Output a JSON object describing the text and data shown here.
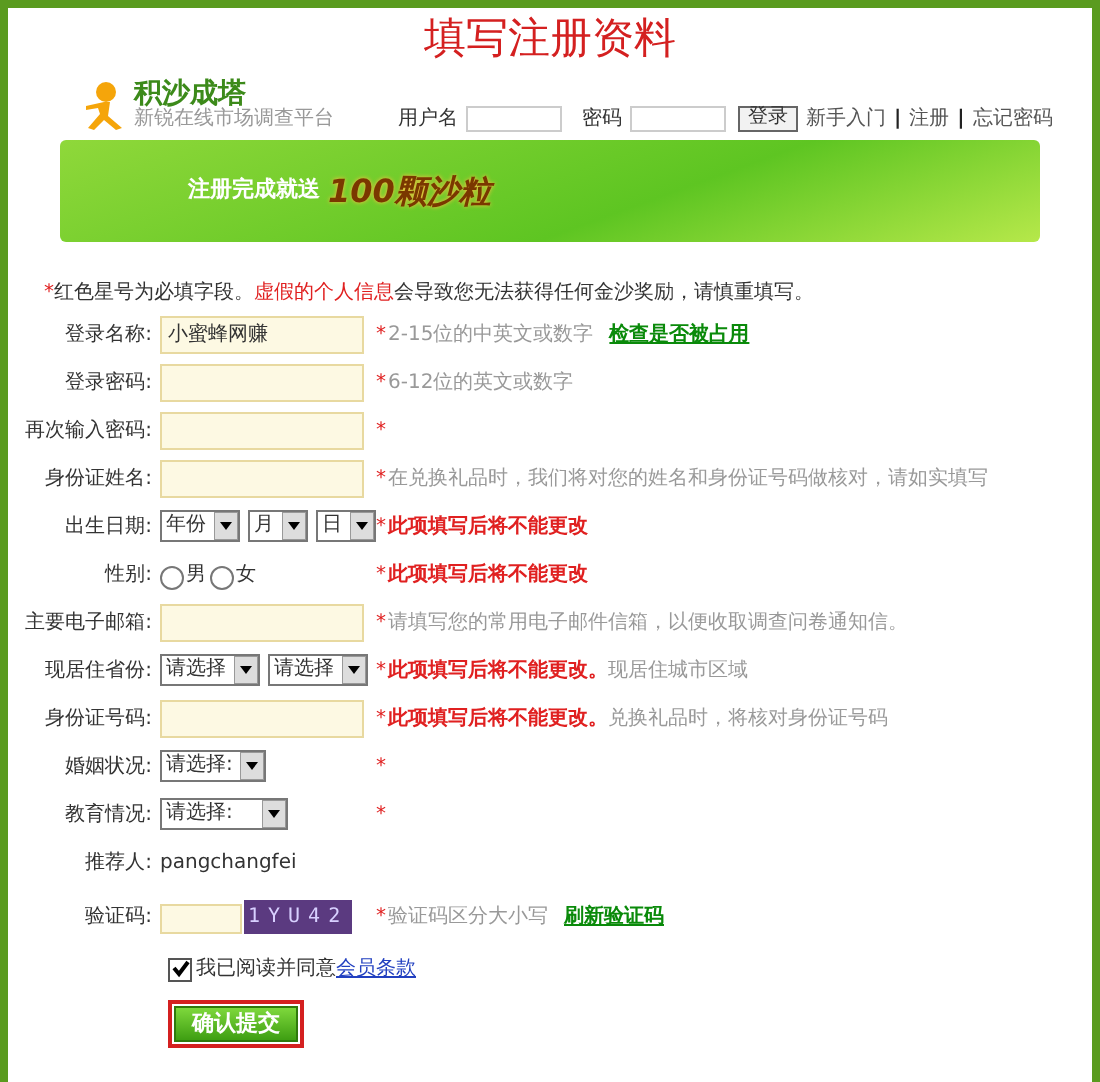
{
  "page_title": "填写注册资料",
  "logo": {
    "name": "积沙成塔",
    "slogan": "新锐在线市场调查平台"
  },
  "login": {
    "username_label": "用户名",
    "password_label": "密码",
    "button": "登录",
    "nav": [
      {
        "kind": "link",
        "text": "新手入门"
      },
      {
        "kind": "sep",
        "text": "|"
      },
      {
        "kind": "link",
        "text": "注册"
      },
      {
        "kind": "sep",
        "text": "|"
      },
      {
        "kind": "link",
        "text": "忘记密码"
      }
    ]
  },
  "banner": {
    "text": "注册完成就送",
    "highlight": "100颗沙粒"
  },
  "intro": {
    "star": "*",
    "text": "红色星号为必填字段。",
    "warning": "虚假的个人信息",
    "rest": "会导致您无法获得任何金沙奖励，请慎重填写。"
  },
  "fields": [
    {
      "label": "登录名称:",
      "kind": "input",
      "value": "小蜜蜂网赚",
      "star": "*",
      "notes": [
        {
          "kind": "hint",
          "text": "2-15位的中英文或数字"
        },
        {
          "kind": "link",
          "text": "检查是否被占用"
        }
      ]
    },
    {
      "label": "登录密码:",
      "kind": "input",
      "star": "*",
      "notes": [
        {
          "kind": "hint",
          "text": "6-12位的英文或数字"
        }
      ]
    },
    {
      "label": "再次输入密码:",
      "kind": "input",
      "star": "*"
    },
    {
      "label": "身份证姓名:",
      "kind": "input",
      "star": "*",
      "notes": [
        {
          "kind": "hint",
          "text": "在兑换礼品时，我们将对您的姓名和身份证号码做核对，请如实填写"
        }
      ]
    },
    {
      "label": "出生日期:",
      "kind": "selects",
      "selects": [
        "年份",
        "月",
        "日"
      ],
      "star": "*",
      "notes": [
        {
          "kind": "warn",
          "text": "此项填写后将不能更改"
        }
      ]
    },
    {
      "label": "性别:",
      "kind": "radios",
      "options": [
        {
          "label": "男",
          "selected": false
        },
        {
          "label": "女",
          "selected": false
        }
      ],
      "star": "*",
      "notes": [
        {
          "kind": "warn",
          "text": "此项填写后将不能更改"
        }
      ]
    },
    {
      "label": "主要电子邮箱:",
      "kind": "input",
      "star": "*",
      "notes": [
        {
          "kind": "hint",
          "text": "请填写您的常用电子邮件信箱，以便收取调查问卷通知信。"
        }
      ]
    },
    {
      "label": "现居住省份:",
      "kind": "selects",
      "selects": [
        "请选择",
        "请选择"
      ],
      "star": "*",
      "notes": [
        {
          "kind": "warn",
          "text": "此项填写后将不能更改。"
        },
        {
          "kind": "hint",
          "text": "现居住城市区域"
        }
      ]
    },
    {
      "label": "身份证号码:",
      "kind": "input",
      "star": "*",
      "notes": [
        {
          "kind": "warn",
          "text": "此项填写后将不能更改。"
        },
        {
          "kind": "hint",
          "text": "兑换礼品时，将核对身份证号码"
        }
      ]
    },
    {
      "label": "婚姻状况:",
      "kind": "selects",
      "selects": [
        "请选择:"
      ],
      "star": "*"
    },
    {
      "label": "教育情况:",
      "kind": "selects",
      "wide": true,
      "selects": [
        "请选择:"
      ],
      "star": "*"
    },
    {
      "label": "推荐人:",
      "kind": "text",
      "value": "pangchangfei"
    },
    {
      "label": "验证码:",
      "kind": "captcha",
      "code": "1YU42",
      "star": "*",
      "notes": [
        {
          "kind": "hint",
          "text": "验证码区分大小写"
        },
        {
          "kind": "link",
          "text": "刷新验证码"
        }
      ]
    }
  ],
  "agree": {
    "checked": true,
    "text": "我已阅读并同意",
    "link": "会员条款"
  },
  "submit": "确认提交"
}
